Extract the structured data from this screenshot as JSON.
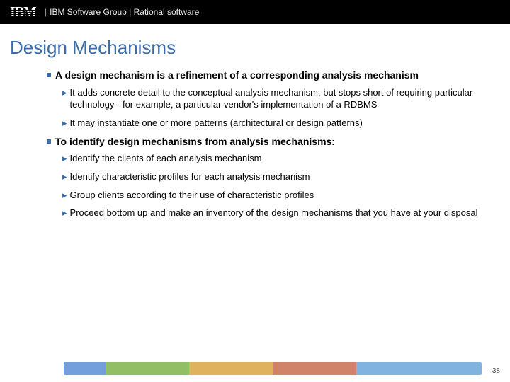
{
  "header": {
    "logo_text": "IBM",
    "text": "IBM Software Group | Rational software"
  },
  "title": "Design Mechanisms",
  "sections": [
    {
      "head": "A design mechanism is a refinement of a corresponding analysis mechanism",
      "items": [
        "It adds concrete detail to the conceptual analysis mechanism, but stops short of requiring particular technology - for example, a particular vendor's implementation of a RDBMS",
        "It may instantiate one or more patterns (architectural or design patterns)"
      ]
    },
    {
      "head": "To identify design mechanisms from analysis mechanisms:",
      "items": [
        "Identify the clients of each analysis mechanism",
        "Identify characteristic profiles for each analysis mechanism",
        "Group clients according to their use of characteristic profiles",
        "Proceed bottom up and make an inventory of the design mechanisms that you have at your disposal"
      ]
    }
  ],
  "page_number": "38"
}
